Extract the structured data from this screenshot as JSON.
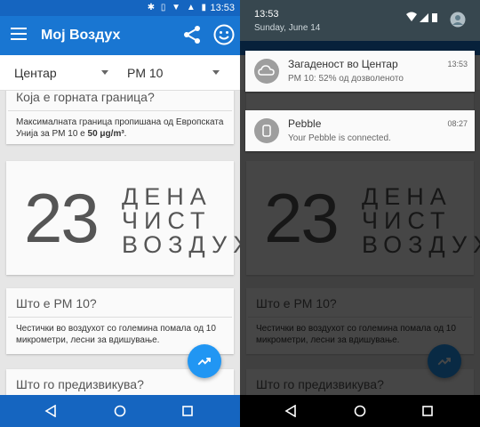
{
  "status": {
    "time": "13:53"
  },
  "app": {
    "title": "Мој Воздух",
    "location": "Центар",
    "pollutant": "PM 10"
  },
  "cards": {
    "limit_title": "Која е горната граница?",
    "limit_text": "Максималната граница пропишана од Европската Унија за PM 10 е",
    "limit_value": "50 μg/m³",
    "days_number": "23",
    "days_word1": "ДЕНА",
    "days_word2": "ЧИСТ",
    "days_word3": "ВОЗДУХ",
    "pm_title": "Што е PM 10?",
    "pm_text": "Честички во воздухот со големина помала од 10 микрометри, лесни за вдишување.",
    "cause_title": "Што го предизвикува?"
  },
  "shade": {
    "time": "13:53",
    "date": "Sunday, June 14"
  },
  "notifications": [
    {
      "title": "Загаденост во Центар",
      "text": "PM 10: 52% од дозволеното",
      "time": "13:53",
      "icon": "cloud-icon"
    },
    {
      "title": "Pebble",
      "text": "Your Pebble is connected.",
      "time": "08:27",
      "icon": "watch-icon"
    }
  ],
  "colors": {
    "primary": "#1976d2",
    "status_bar": "#1565c0",
    "fab": "#2196f3",
    "shade_header": "#37474f"
  }
}
